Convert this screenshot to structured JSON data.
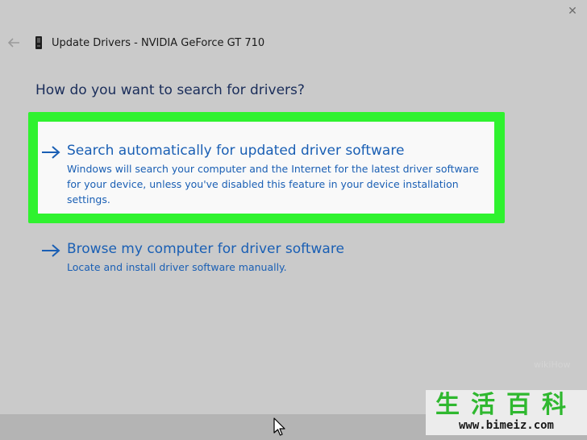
{
  "window": {
    "title": "Update Drivers - NVIDIA GeForce GT 710",
    "close_glyph": "✕"
  },
  "page": {
    "heading": "How do you want to search for drivers?"
  },
  "options": [
    {
      "title": "Search automatically for updated driver software",
      "description": "Windows will search your computer and the Internet for the latest driver software for your device, unless you've disabled this feature in your device installation settings.",
      "highlighted": true
    },
    {
      "title": "Browse my computer for driver software",
      "description": "Locate and install driver software manually.",
      "highlighted": false
    }
  ],
  "watermark": {
    "chars": "生活百科",
    "url": "www.bimeiz.com",
    "faint_text": "wikiHow"
  },
  "icons": {
    "back": "back-arrow-icon",
    "device": "graphics-card-icon",
    "option_arrow": "right-arrow-icon",
    "cursor": "mouse-pointer-icon"
  },
  "colors": {
    "link_blue": "#1a5fb4",
    "heading_navy": "#1a2d5a",
    "highlight_green": "#2ff22f",
    "window_bg": "#cacaca",
    "card_bg": "#f9f9f9",
    "watermark_green": "#2fb82f"
  }
}
